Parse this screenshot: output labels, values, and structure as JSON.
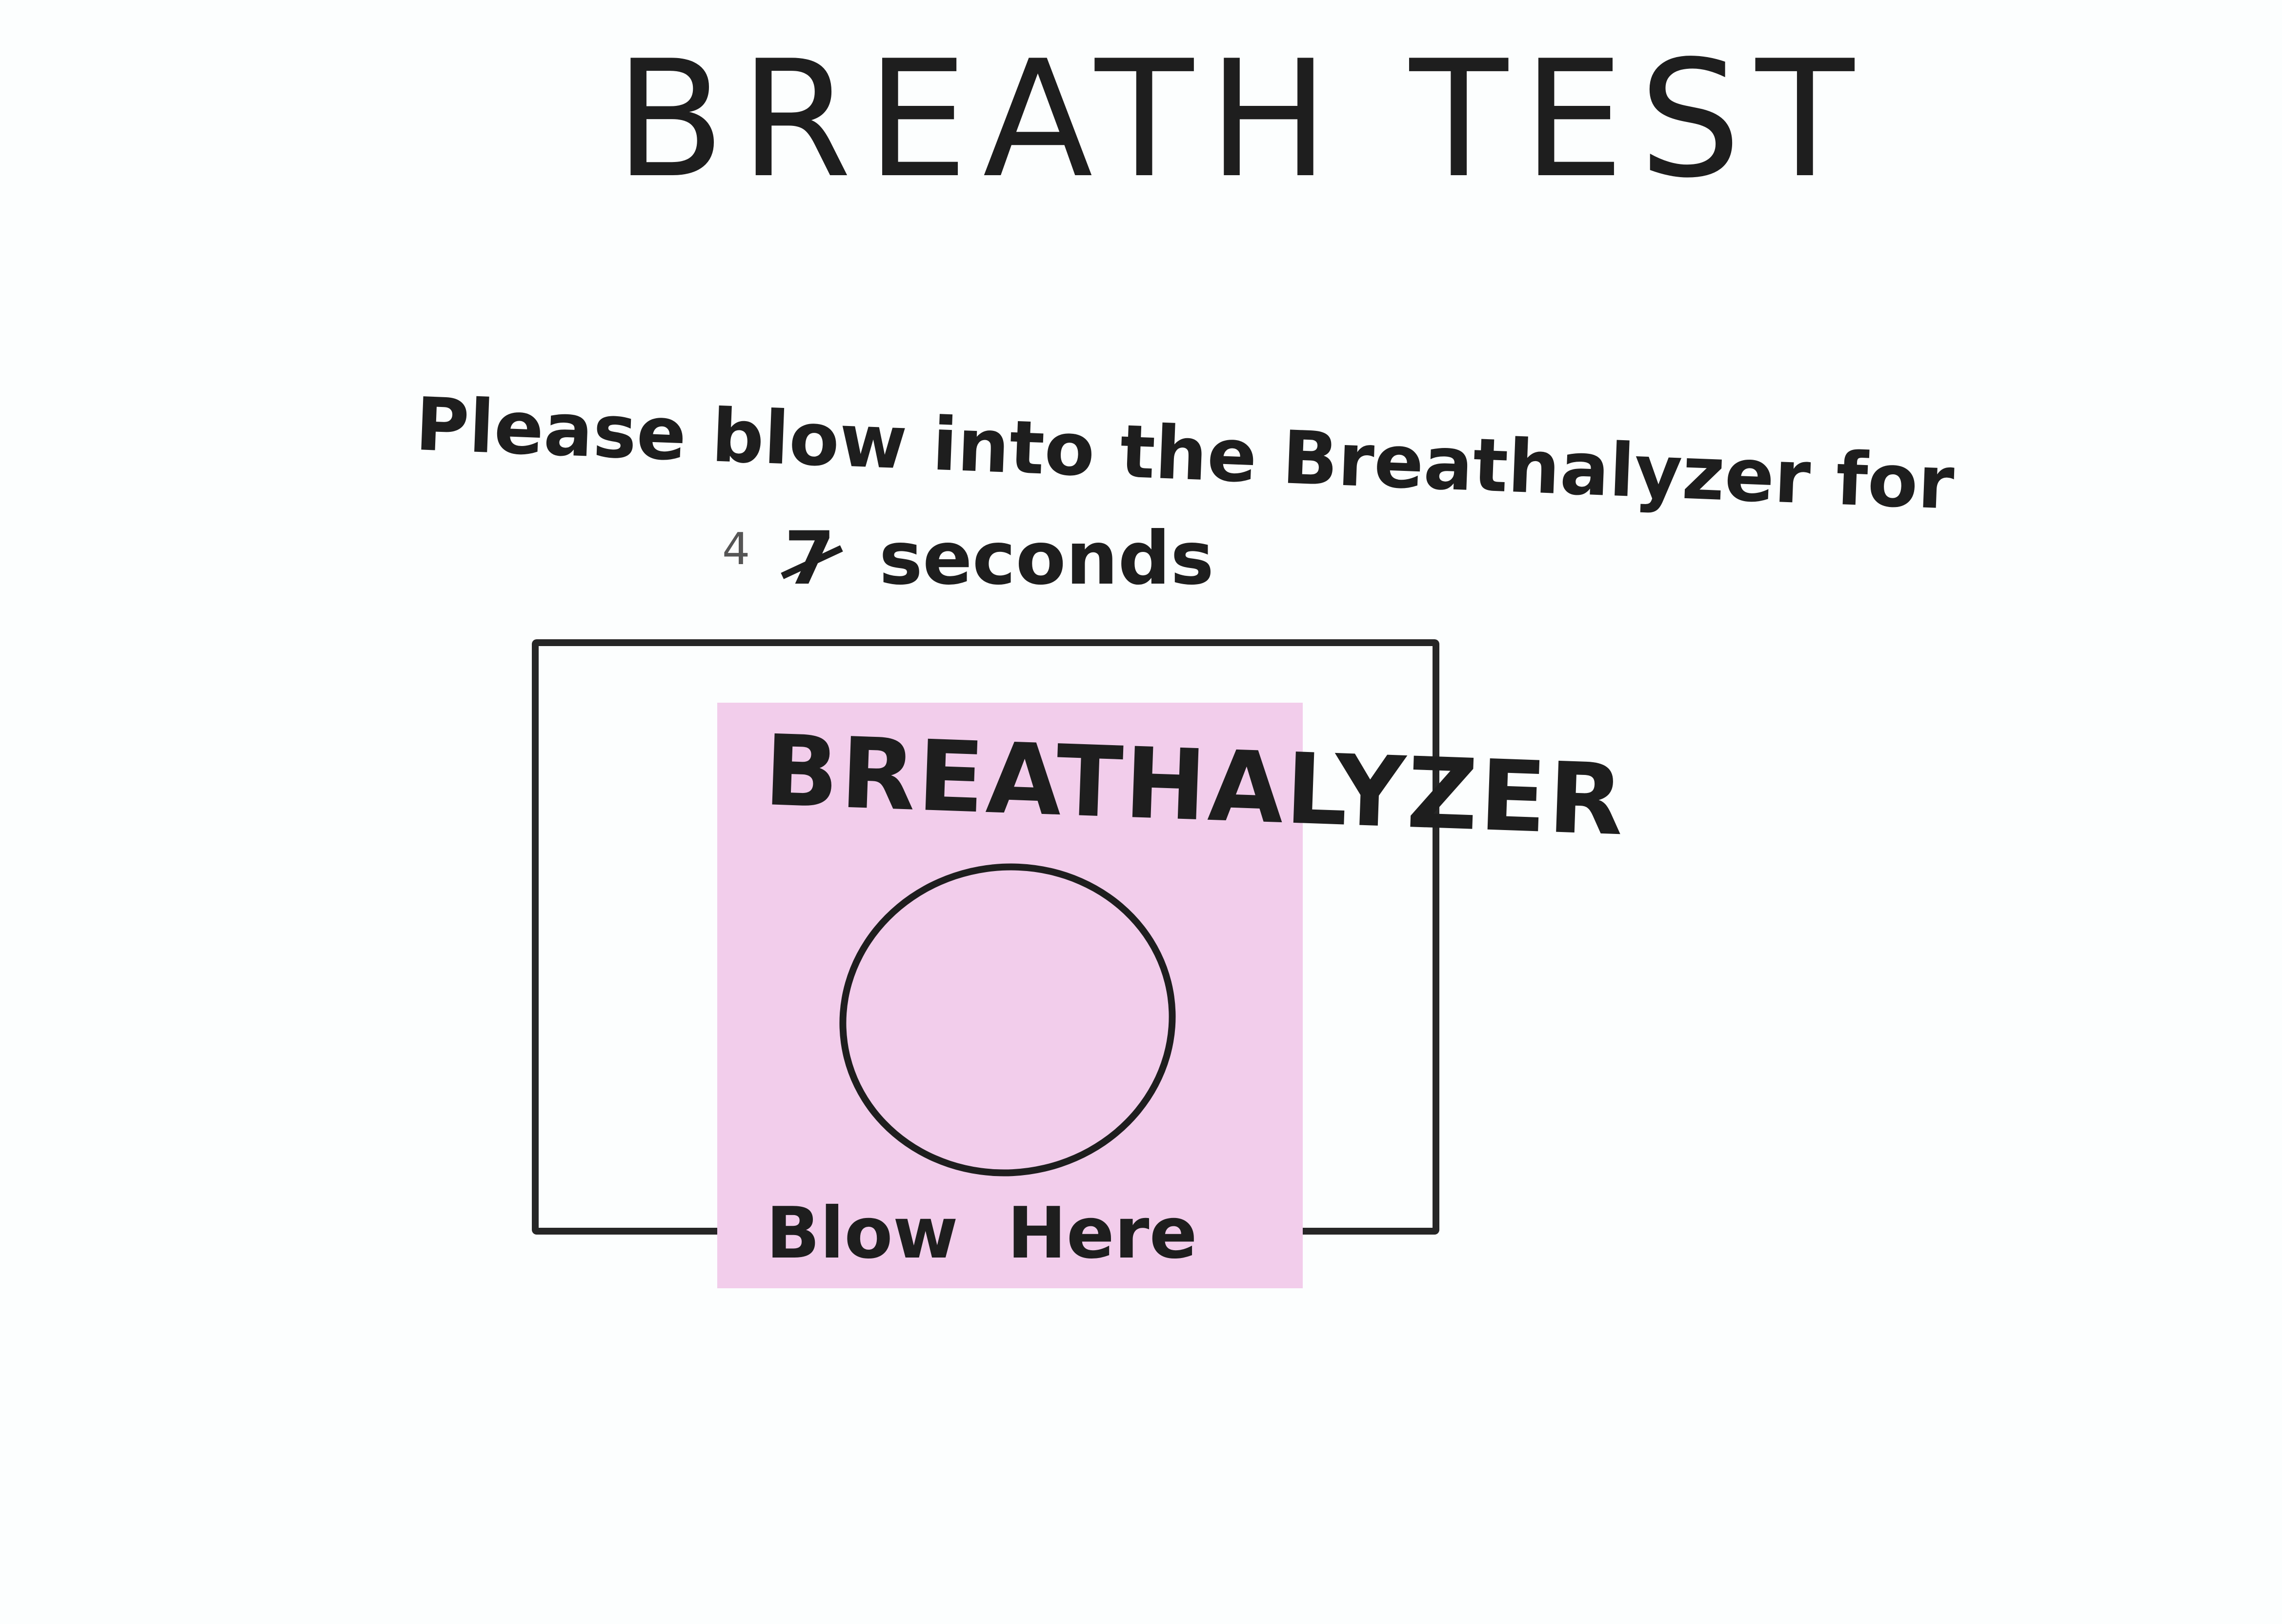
{
  "screen": {
    "title": "Breath Test",
    "instruction": "Please blow into the Breathalyzer for",
    "duration": {
      "value": "4",
      "crossed_out_value": "7",
      "unit": "seconds"
    },
    "breathalyzer": {
      "label": "BREATHALYZER",
      "prompt": "Blow Here",
      "icon": "blow-circle-icon"
    }
  },
  "colors": {
    "background": "#fcfefe",
    "ink": "#1e1e1e",
    "sticky_note": "#f2cdeb"
  }
}
